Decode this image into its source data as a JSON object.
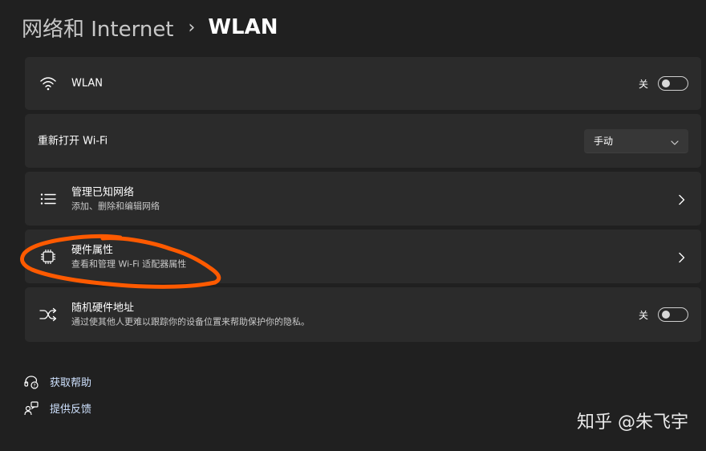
{
  "header": {
    "parent": "网络和 Internet",
    "separator": "›",
    "current": "WLAN"
  },
  "rows": [
    {
      "id": "wlan",
      "icon": "wifi-icon",
      "title": "WLAN",
      "toggle_label": "关",
      "toggle_state": "off"
    },
    {
      "id": "reopen-wifi",
      "title": "重新打开 Wi-Fi",
      "dropdown_value": "手动"
    },
    {
      "id": "known-networks",
      "icon": "list-icon",
      "title": "管理已知网络",
      "subtitle": "添加、删除和编辑网络"
    },
    {
      "id": "hardware-properties",
      "icon": "chip-icon",
      "title": "硬件属性",
      "subtitle": "查看和管理 Wi-Fi 适配器属性"
    },
    {
      "id": "random-hw-address",
      "icon": "shuffle-icon",
      "title": "随机硬件地址",
      "subtitle": "通过使其他人更难以跟踪你的设备位置来帮助保护你的隐私。",
      "toggle_label": "关",
      "toggle_state": "off"
    }
  ],
  "links": {
    "help": "获取帮助",
    "feedback": "提供反馈"
  },
  "watermark": "知乎 @朱飞宇",
  "colors": {
    "background": "#202020",
    "card": "#2b2b2b",
    "annotation": "#ff5a00",
    "link": "#cfe2ff"
  }
}
